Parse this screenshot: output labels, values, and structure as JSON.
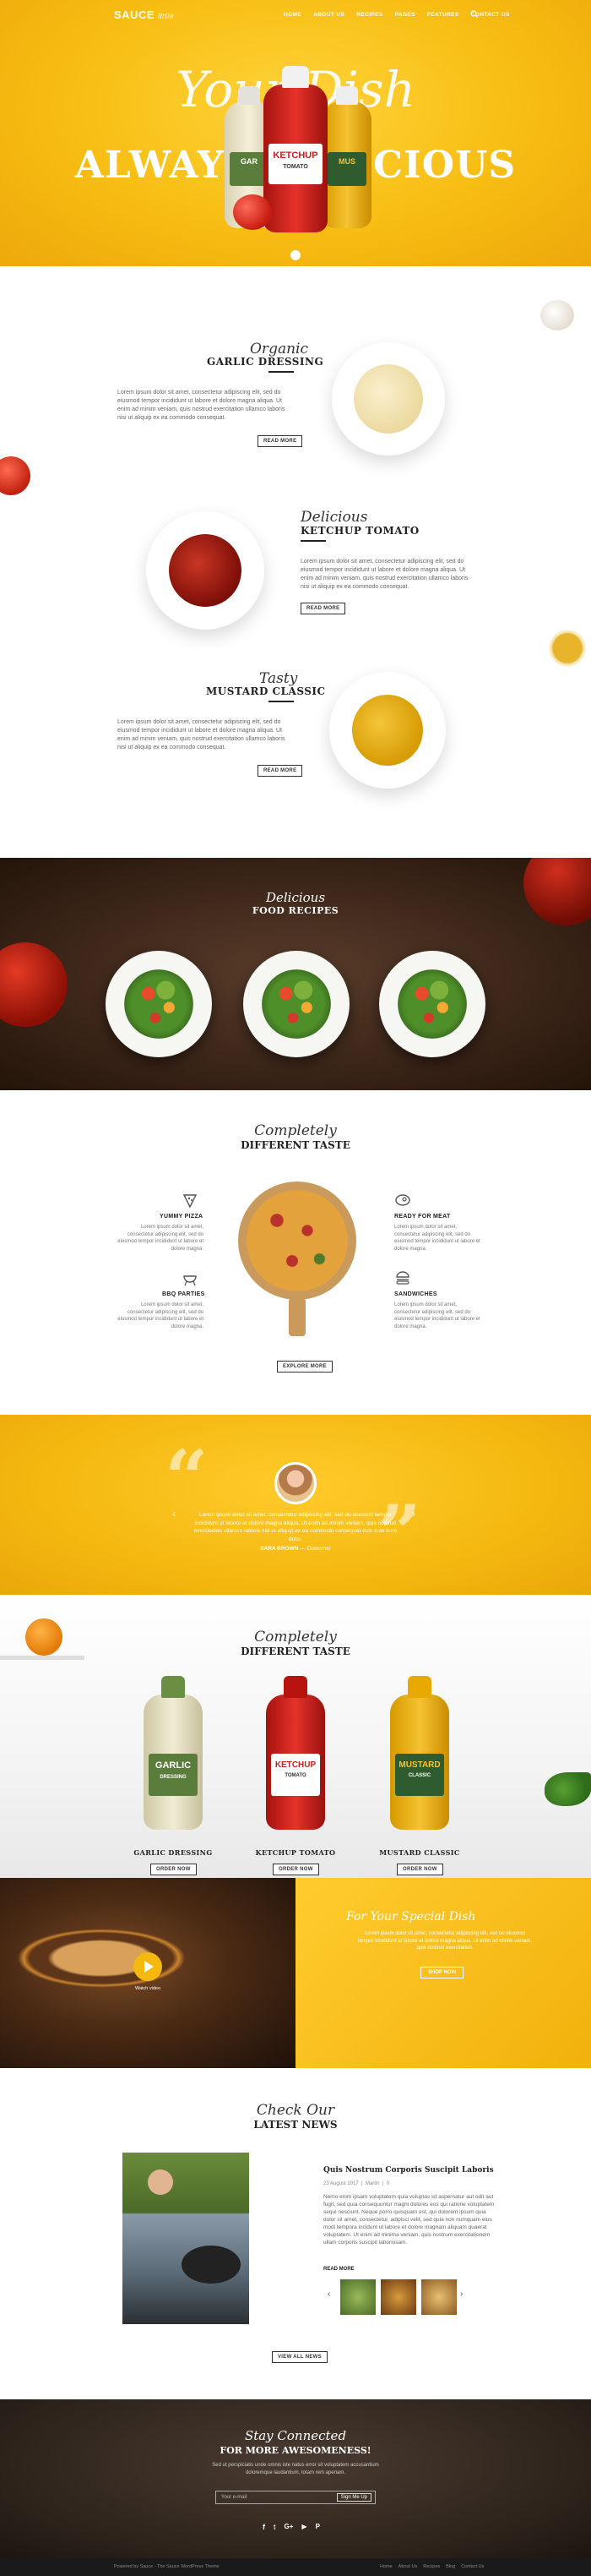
{
  "brand": {
    "name": "SAUCE",
    "suffix": "little"
  },
  "nav": {
    "items": [
      "HOME",
      "ABOUT US",
      "RECIPES",
      "PAGES",
      "FEATURES",
      "CONTACT US"
    ],
    "search_icon": "search-icon"
  },
  "hero": {
    "script": "Your Dish",
    "headline": "ALWAYS DELICIOUS"
  },
  "products": [
    {
      "script": "Organic",
      "title": "GARLIC DRESSING",
      "text": "Lorem ipsum dolor sit amet, consectetur adipiscing elit, sed do eiusmod tempor incididunt ut labore et dolore magna aliqua. Ut enim ad minim veniam, quis nostrud exercitation ullamco laboris nisi ut aliquip ex ea commodo consequat.",
      "button": "READ MORE"
    },
    {
      "script": "Delicious",
      "title": "KETCHUP TOMATO",
      "text": "Lorem ipsum dolor sit amet, consectetur adipiscing elit, sed do eiusmod tempor incididunt ut labore et dolore magna aliqua. Ut enim ad minim veniam, quis nostrud exercitation ullamco laboris nisi ut aliquip ex ea commodo consequat.",
      "button": "READ MORE"
    },
    {
      "script": "Tasty",
      "title": "MUSTARD CLASSIC",
      "text": "Lorem ipsum dolor sit amet, consectetur adipiscing elit, sed do eiusmod tempor incididunt ut labore et dolore magna aliqua. Ut enim ad minim veniam, quis nostrud exercitation ullamco laboris nisi ut aliquip ex ea commodo consequat.",
      "button": "READ MORE"
    }
  ],
  "recipes": {
    "script": "Delicious",
    "title": "FOOD RECIPES"
  },
  "taste": {
    "script": "Completely",
    "title": "DIFFERENT TASTE",
    "features": [
      {
        "icon": "pizza-slice-icon",
        "title": "YUMMY PIZZA",
        "text": "Lorem ipsum dolor sit amet, consectetur adipiscing elit, sed do eiusmod tempor incididunt ut labore et dolore magna."
      },
      {
        "icon": "grill-icon",
        "title": "BBQ PARTIES",
        "text": "Lorem ipsum dolor sit amet, consectetur adipiscing elit, sed do eiusmod tempor incididunt ut labore et dolore magna."
      },
      {
        "icon": "steak-icon",
        "title": "READY FOR MEAT",
        "text": "Lorem ipsum dolor sit amet, consectetur adipiscing elit, sed do eiusmod tempor incididunt ut labore et dolore magna."
      },
      {
        "icon": "burger-icon",
        "title": "SANDWICHES",
        "text": "Lorem ipsum dolor sit amet, consectetur adipiscing elit, sed do eiusmod tempor incididunt ut labore et dolore magna."
      }
    ],
    "button": "EXPLORE MORE"
  },
  "testimonial": {
    "text": "Lorem ipsum dolor sit amet, consectetur adipiscing elit, sed do eiusmod tempor incididunt ut labore et dolore magna aliqua. Ut enim ad minim veniam, quis nostrud exercitation ullamco laboris nisi ut aliquip ex ea commodo consequat duis aute irure dolor.",
    "author": "SARA BROWN",
    "role": "Customer"
  },
  "bottles": {
    "script": "Completely",
    "title": "DIFFERENT TASTE",
    "items": [
      {
        "name": "GARLIC DRESSING",
        "label": "GARLIC",
        "sub": "DRESSING",
        "button": "ORDER NOW"
      },
      {
        "name": "KETCHUP TOMATO",
        "label": "KETCHUP",
        "sub": "TOMATO",
        "button": "ORDER NOW"
      },
      {
        "name": "MUSTARD CLASSIC",
        "label": "MUSTARD",
        "sub": "CLASSIC",
        "button": "ORDER NOW"
      }
    ]
  },
  "special": {
    "video_label": "Watch video",
    "script": "For Your Special Dish",
    "text": "Lorem ipsum dolor sit amet, consectetur adipiscing elit, sed do eiusmod tempor incididunt ut labore et dolore magna aliqua. Ut enim ad minim veniam, quis nostrud exercitation.",
    "button": "SHOP NOW"
  },
  "news": {
    "script": "Check Our",
    "title": "LATEST NEWS",
    "post_title": "Quis Nostrum Corporis Suscipit Laboris",
    "date": "23 August 2017",
    "author": "Martin",
    "comments": "0",
    "text": "Nemo enim ipsam voluptatem quia voluptas sit aspernatur aut odit aut fugit, sed quia consequuntur magni dolores eos qui ratione voluptatem sequi nesciunt. Neque porro quisquam est, qui dolorem ipsum quia dolor sit amet, consectetur, adipisci velit, sed quia non numquam eius modi tempora incidunt ut labore et dolore magnam aliquam quaerat voluptatem. Ut enim ad minima veniam, quis nostrum exercitationem ullam corporis suscipit laboriosam.",
    "read_more": "READ MORE",
    "button": "VIEW ALL NEWS"
  },
  "connect": {
    "script": "Stay Connected",
    "title": "FOR MORE AWESOMENESS!",
    "text": "Sed ut perspiciatis unde omnis iste natus error sit voluptatem accusantium doloremque laudantium, totam rem aperiam.",
    "placeholder": "Your e-mail",
    "button": "Sign Me Up",
    "social": [
      "facebook-icon",
      "twitter-icon",
      "google-plus-icon",
      "youtube-icon",
      "pinterest-icon"
    ]
  },
  "footer": {
    "copyright": "Powered by Sauce - The Sauce WordPress Theme",
    "links": [
      "Home",
      "About Us",
      "Recipes",
      "Blog",
      "Contact Us"
    ]
  },
  "colors": {
    "accent": "#f5b80f",
    "dark": "#2b2018",
    "ketchup": "#c8201f",
    "mustard": "#f2b000",
    "garlic": "#efe6c4"
  }
}
